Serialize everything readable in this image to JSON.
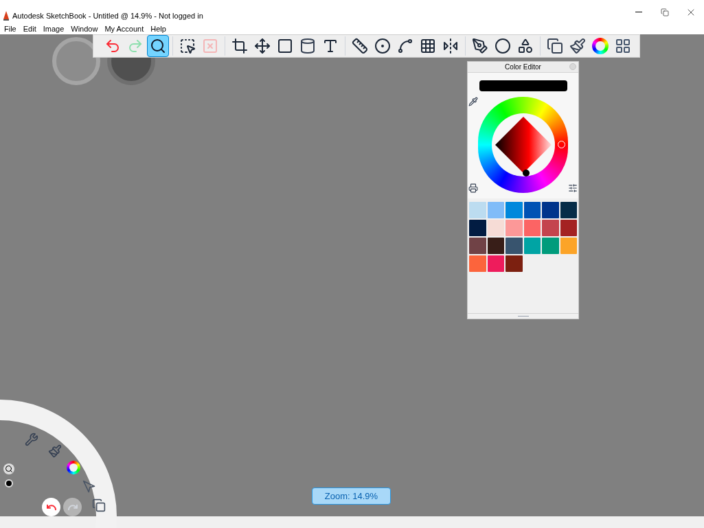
{
  "window": {
    "title": "Autodesk SketchBook - Untitled @ 14.9% - Not logged in"
  },
  "menu": [
    "File",
    "Edit",
    "Image",
    "Window",
    "My Account",
    "Help"
  ],
  "toolbar": [
    {
      "tools": [
        {
          "kind": "undo",
          "selected": false,
          "disabled": false
        },
        {
          "kind": "redo",
          "selected": false,
          "disabled": true
        },
        {
          "kind": "zoom",
          "selected": true,
          "disabled": false
        }
      ]
    },
    {
      "tools": [
        {
          "kind": "select",
          "selected": false,
          "disabled": false
        },
        {
          "kind": "clear-selection",
          "selected": false,
          "disabled": true
        }
      ]
    },
    {
      "tools": [
        {
          "kind": "crop",
          "selected": false,
          "disabled": false
        },
        {
          "kind": "transform",
          "selected": false,
          "disabled": false
        },
        {
          "kind": "distort",
          "selected": false,
          "disabled": false
        },
        {
          "kind": "fill",
          "selected": false,
          "disabled": false
        },
        {
          "kind": "text",
          "selected": false,
          "disabled": false
        }
      ]
    },
    {
      "tools": [
        {
          "kind": "ruler",
          "selected": false,
          "disabled": false
        },
        {
          "kind": "ellipse",
          "selected": false,
          "disabled": false
        },
        {
          "kind": "curve",
          "selected": false,
          "disabled": false
        },
        {
          "kind": "perspective",
          "selected": false,
          "disabled": false
        },
        {
          "kind": "symmetry",
          "selected": false,
          "disabled": false
        }
      ]
    },
    {
      "tools": [
        {
          "kind": "stroke",
          "selected": false,
          "disabled": false
        },
        {
          "kind": "circle",
          "selected": false,
          "disabled": false
        },
        {
          "kind": "shapes",
          "selected": false,
          "disabled": false
        }
      ]
    },
    {
      "tools": [
        {
          "kind": "layers",
          "selected": false,
          "disabled": false
        },
        {
          "kind": "brushes",
          "selected": false,
          "disabled": false
        },
        {
          "kind": "color",
          "selected": false,
          "disabled": false
        },
        {
          "kind": "palettes",
          "selected": false,
          "disabled": false
        }
      ]
    }
  ],
  "color_editor": {
    "title": "Color Editor",
    "swatches": [
      {
        "color": "#bcdcf0"
      },
      {
        "color": "#80bcf8"
      },
      {
        "color": "#0088dc"
      },
      {
        "color": "#0052b4"
      },
      {
        "color": "#00348c"
      },
      {
        "color": "#062c48"
      },
      {
        "color": "#021c42"
      },
      {
        "color": "#f6dcd6"
      },
      {
        "color": "#fc9898"
      },
      {
        "color": "#fc6464"
      },
      {
        "color": "#c4444e"
      },
      {
        "color": "#a42222"
      },
      {
        "color": "#704246"
      },
      {
        "color": "#381e18"
      },
      {
        "color": "#38546e"
      },
      {
        "color": "#00a4a4"
      },
      {
        "color": "#009c7c"
      },
      {
        "color": "#fca428"
      },
      {
        "color": "#fc643c"
      },
      {
        "color": "#ee1c5c"
      },
      {
        "color": "#7c2010"
      }
    ]
  },
  "zoom_badge": "Zoom: 14.9%"
}
